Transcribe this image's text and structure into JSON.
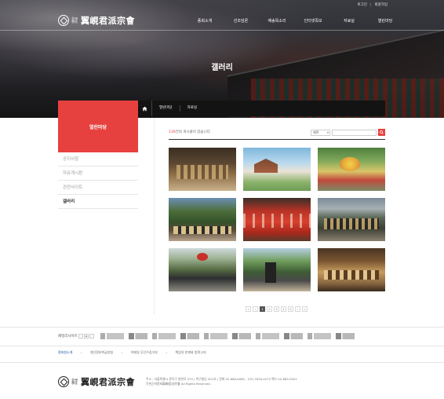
{
  "util": {
    "login": "로그인",
    "join": "회원가입"
  },
  "logo": {
    "small": "全州 李氏",
    "big": "翼峴君派宗會"
  },
  "gnb": [
    "종회소개",
    "선조담론",
    "예송목소리",
    "인터넷족보",
    "자료실",
    "열린마당"
  ],
  "hero": {
    "title": "갤러리"
  },
  "side": {
    "title": "열린마당",
    "items": [
      "공지사항",
      "자유게시판",
      "관련사이트",
      "갤러리"
    ],
    "active_index": 3
  },
  "breadcrumb": {
    "home_icon": "home-icon",
    "items": [
      "열린마당",
      "자료실"
    ]
  },
  "gallery": {
    "count_prefix": "139",
    "count_suffix": "건의 게시물이 있습니다",
    "search_select": "제목",
    "search_placeholder": "",
    "search_icon": "search-icon",
    "items": [
      {
        "alt": "photo-1"
      },
      {
        "alt": "photo-2"
      },
      {
        "alt": "photo-3"
      },
      {
        "alt": "photo-4"
      },
      {
        "alt": "photo-5"
      },
      {
        "alt": "photo-6"
      },
      {
        "alt": "photo-7"
      },
      {
        "alt": "photo-8"
      },
      {
        "alt": "photo-9"
      }
    ]
  },
  "pager": {
    "first": "«",
    "prev": "‹",
    "pages": [
      "1",
      "2",
      "3",
      "4",
      "5"
    ],
    "current": "1",
    "next": "›",
    "last": "»"
  },
  "family": {
    "label": "패밀리사이트",
    "prev": "‹",
    "stop": "▪",
    "next": "›"
  },
  "footer": {
    "links": [
      "종회원소개",
      "개인정보취급방침",
      "이메일 무단수집거부",
      "책임의 한계와 법적고지"
    ],
    "address": "주소 : 서울특별시 관악구 봉천로 575 | 복구빌딩 501호 | 전화 02-886-6080 , 070-7678-0275 팩스 02-885-0941",
    "copyright": "익현군파종회翼峴君派宗會 All Rights Reserved."
  },
  "colors": {
    "accent": "#e7413f",
    "dark": "#131313"
  }
}
